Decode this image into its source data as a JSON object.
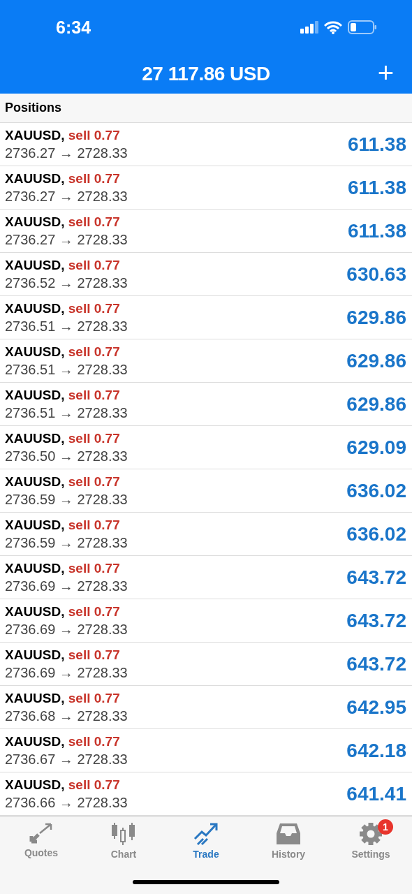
{
  "status_bar": {
    "time": "6:34"
  },
  "header": {
    "balance": "27 117.86 USD",
    "add": "+"
  },
  "section_title": "Positions",
  "positions": [
    {
      "symbol": "XAUUSD,",
      "side": "sell 0.77",
      "prices": "2736.27 → 2728.33",
      "profit": "611.38"
    },
    {
      "symbol": "XAUUSD,",
      "side": "sell 0.77",
      "prices": "2736.27 → 2728.33",
      "profit": "611.38"
    },
    {
      "symbol": "XAUUSD,",
      "side": "sell 0.77",
      "prices": "2736.27 → 2728.33",
      "profit": "611.38"
    },
    {
      "symbol": "XAUUSD,",
      "side": "sell 0.77",
      "prices": "2736.52 → 2728.33",
      "profit": "630.63"
    },
    {
      "symbol": "XAUUSD,",
      "side": "sell 0.77",
      "prices": "2736.51 → 2728.33",
      "profit": "629.86"
    },
    {
      "symbol": "XAUUSD,",
      "side": "sell 0.77",
      "prices": "2736.51 → 2728.33",
      "profit": "629.86"
    },
    {
      "symbol": "XAUUSD,",
      "side": "sell 0.77",
      "prices": "2736.51 → 2728.33",
      "profit": "629.86"
    },
    {
      "symbol": "XAUUSD,",
      "side": "sell 0.77",
      "prices": "2736.50 → 2728.33",
      "profit": "629.09"
    },
    {
      "symbol": "XAUUSD,",
      "side": "sell 0.77",
      "prices": "2736.59 → 2728.33",
      "profit": "636.02"
    },
    {
      "symbol": "XAUUSD,",
      "side": "sell 0.77",
      "prices": "2736.59 → 2728.33",
      "profit": "636.02"
    },
    {
      "symbol": "XAUUSD,",
      "side": "sell 0.77",
      "prices": "2736.69 → 2728.33",
      "profit": "643.72"
    },
    {
      "symbol": "XAUUSD,",
      "side": "sell 0.77",
      "prices": "2736.69 → 2728.33",
      "profit": "643.72"
    },
    {
      "symbol": "XAUUSD,",
      "side": "sell 0.77",
      "prices": "2736.69 → 2728.33",
      "profit": "643.72"
    },
    {
      "symbol": "XAUUSD,",
      "side": "sell 0.77",
      "prices": "2736.68 → 2728.33",
      "profit": "642.95"
    },
    {
      "symbol": "XAUUSD,",
      "side": "sell 0.77",
      "prices": "2736.67 → 2728.33",
      "profit": "642.18"
    },
    {
      "symbol": "XAUUSD,",
      "side": "sell 0.77",
      "prices": "2736.66 → 2728.33",
      "profit": "641.41"
    }
  ],
  "tabs": [
    {
      "kind": "quotes",
      "label": "Quotes",
      "selected": false
    },
    {
      "kind": "chart",
      "label": "Chart",
      "selected": false
    },
    {
      "kind": "trade",
      "label": "Trade",
      "selected": true
    },
    {
      "kind": "history",
      "label": "History",
      "selected": false
    },
    {
      "kind": "settings",
      "label": "Settings",
      "selected": false,
      "badge": "1"
    }
  ]
}
